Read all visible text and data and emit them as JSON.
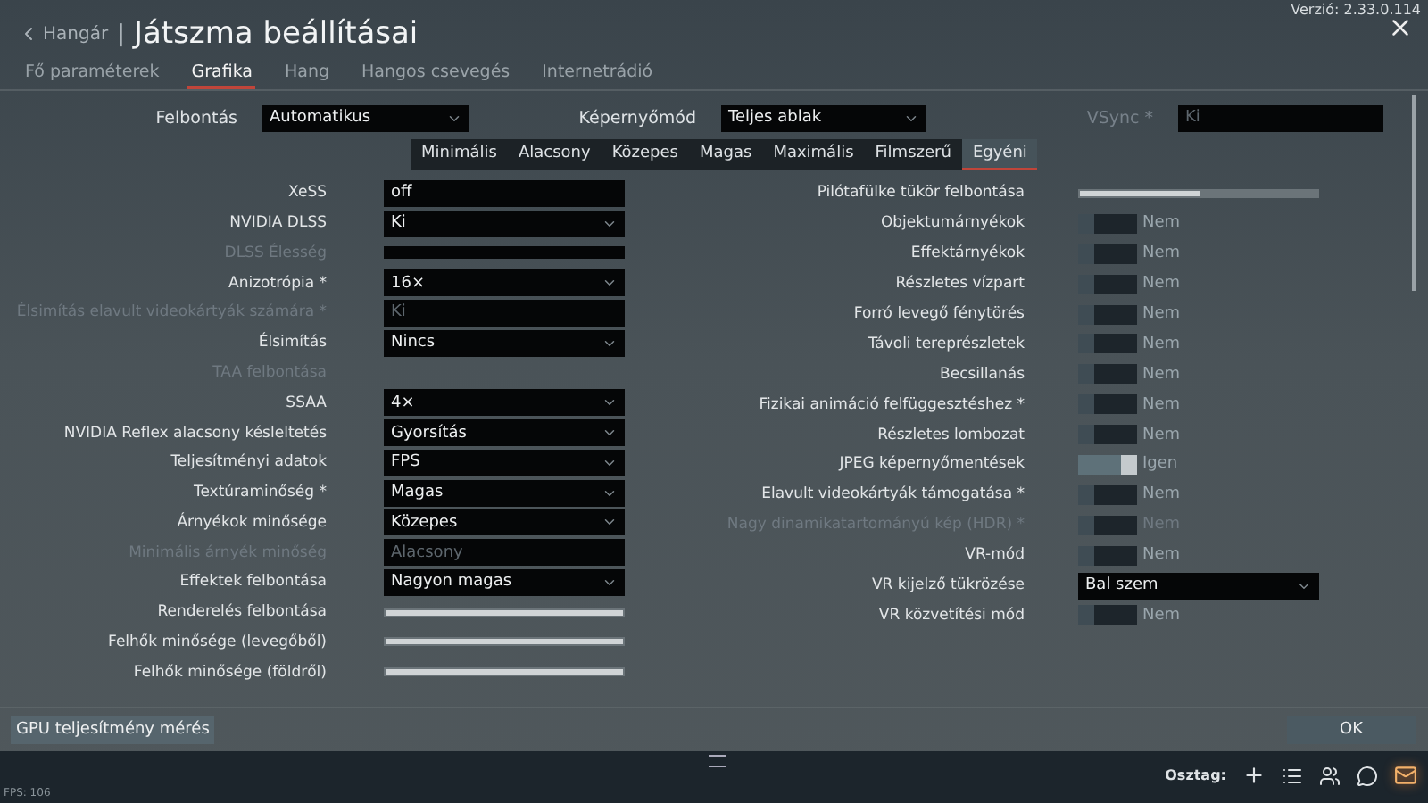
{
  "header": {
    "back": "Hangár",
    "separator": "|",
    "title": "Játszma beállításai",
    "version": "Verzió: 2.33.0.114"
  },
  "tabs": [
    {
      "label": "Fő paraméterek",
      "selected": false
    },
    {
      "label": "Grafika",
      "selected": true
    },
    {
      "label": "Hang",
      "selected": false
    },
    {
      "label": "Hangos csevegés",
      "selected": false
    },
    {
      "label": "Internetrádió",
      "selected": false
    }
  ],
  "top_settings": [
    {
      "label": "Felbontás",
      "value": "Automatikus",
      "kind": "select",
      "disabled": false
    },
    {
      "label": "Képernyőmód",
      "value": "Teljes ablak",
      "kind": "select",
      "disabled": false
    },
    {
      "label": "VSync *",
      "value": "Ki",
      "kind": "field",
      "disabled": true
    }
  ],
  "presets": [
    {
      "label": "Minimális",
      "selected": false
    },
    {
      "label": "Alacsony",
      "selected": false
    },
    {
      "label": "Közepes",
      "selected": false
    },
    {
      "label": "Magas",
      "selected": false
    },
    {
      "label": "Maximális",
      "selected": false
    },
    {
      "label": "Filmszerű",
      "selected": false
    },
    {
      "label": "Egyéni",
      "selected": true
    }
  ],
  "left_settings": [
    {
      "label": "XeSS",
      "kind": "field",
      "value": "off",
      "disabled": false
    },
    {
      "label": "NVIDIA DLSS",
      "kind": "select",
      "value": "Ki",
      "disabled": false
    },
    {
      "label": "DLSS Élesség",
      "kind": "bar",
      "disabled": true
    },
    {
      "label": "Anizotrópia *",
      "kind": "select",
      "value": "16×",
      "disabled": false
    },
    {
      "label": "Élsimítás elavult videokártyák számára *",
      "kind": "field",
      "value": "Ki",
      "disabled": true
    },
    {
      "label": "Élsimítás",
      "kind": "select",
      "value": "Nincs",
      "disabled": false
    },
    {
      "label": "TAA felbontása",
      "kind": "none",
      "disabled": true
    },
    {
      "label": "SSAA",
      "kind": "select",
      "value": "4×",
      "disabled": false
    },
    {
      "label": "NVIDIA Reflex alacsony késleltetés",
      "kind": "select",
      "value": "Gyorsítás",
      "disabled": false
    },
    {
      "label": "Teljesítményi adatok",
      "kind": "select",
      "value": "FPS",
      "disabled": false
    },
    {
      "label": "Textúraminőség *",
      "kind": "select",
      "value": "Magas",
      "disabled": false
    },
    {
      "label": "Árnyékok minősége",
      "kind": "select",
      "value": "Közepes",
      "disabled": false
    },
    {
      "label": "Minimális árnyék minőség",
      "kind": "field",
      "value": "Alacsony",
      "disabled": true
    },
    {
      "label": "Effektek felbontása",
      "kind": "select",
      "value": "Nagyon magas",
      "disabled": false
    },
    {
      "label": "Renderelés felbontása",
      "kind": "slider",
      "level": 1,
      "disabled": false
    },
    {
      "label": "Felhők minősége (levegőből)",
      "kind": "slider",
      "level": 1,
      "disabled": false
    },
    {
      "label": "Felhők minősége (földről)",
      "kind": "slider",
      "level": 1,
      "disabled": false
    }
  ],
  "right_settings": [
    {
      "label": "Pilótafülke tükör felbontása",
      "kind": "slider",
      "level": 0.5,
      "disabled": false
    },
    {
      "label": "Objektumárnyékok",
      "kind": "toggle",
      "on": false,
      "value": "Nem",
      "disabled": false
    },
    {
      "label": "Effektárnyékok",
      "kind": "toggle",
      "on": false,
      "value": "Nem",
      "disabled": false
    },
    {
      "label": "Részletes vízpart",
      "kind": "toggle",
      "on": false,
      "value": "Nem",
      "disabled": false
    },
    {
      "label": "Forró levegő fénytörés",
      "kind": "toggle",
      "on": false,
      "value": "Nem",
      "disabled": false
    },
    {
      "label": "Távoli tereprészletek",
      "kind": "toggle",
      "on": false,
      "value": "Nem",
      "disabled": false
    },
    {
      "label": "Becsillanás",
      "kind": "toggle",
      "on": false,
      "value": "Nem",
      "disabled": false
    },
    {
      "label": "Fizikai animáció felfüggesztéshez *",
      "kind": "toggle",
      "on": false,
      "value": "Nem",
      "disabled": false
    },
    {
      "label": "Részletes lombozat",
      "kind": "toggle",
      "on": false,
      "value": "Nem",
      "disabled": false
    },
    {
      "label": "JPEG képernyőmentések",
      "kind": "toggle",
      "on": true,
      "value": "Igen",
      "disabled": false
    },
    {
      "label": "Elavult videokártyák támogatása *",
      "kind": "toggle",
      "on": false,
      "value": "Nem",
      "disabled": false
    },
    {
      "label": "Nagy dinamikatartományú kép (HDR) *",
      "kind": "toggle",
      "on": false,
      "value": "Nem",
      "disabled": true
    },
    {
      "label": "VR-mód",
      "kind": "toggle",
      "on": false,
      "value": "Nem",
      "disabled": false
    },
    {
      "label": "VR kijelző tükrözése",
      "kind": "select",
      "value": "Bal szem",
      "disabled": false
    },
    {
      "label": "VR közvetítési mód",
      "kind": "toggle",
      "on": false,
      "value": "Nem",
      "disabled": false
    }
  ],
  "footer": {
    "benchmark": "GPU teljesítmény mérés",
    "ok": "OK"
  },
  "taskbar": {
    "fps": "FPS: 106",
    "squad": "Osztag:"
  }
}
